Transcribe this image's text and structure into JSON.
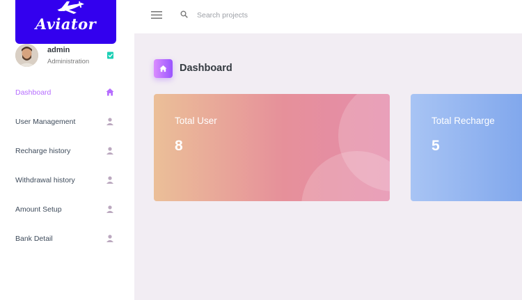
{
  "brand": {
    "name": "Aviator"
  },
  "profile": {
    "name": "admin",
    "role": "Administration"
  },
  "sidebar": {
    "items": [
      {
        "label": "Dashboard",
        "icon": "home-icon",
        "active": true
      },
      {
        "label": "User Management",
        "icon": "user-icon",
        "active": false
      },
      {
        "label": "Recharge history",
        "icon": "user-icon",
        "active": false
      },
      {
        "label": "Withdrawal history",
        "icon": "user-icon",
        "active": false
      },
      {
        "label": "Amount Setup",
        "icon": "user-icon",
        "active": false
      },
      {
        "label": "Bank Detail",
        "icon": "user-icon",
        "active": false
      }
    ]
  },
  "topbar": {
    "search_placeholder": "Search projects",
    "search_value": ""
  },
  "page": {
    "title": "Dashboard"
  },
  "cards": [
    {
      "label": "Total User",
      "value": "8"
    },
    {
      "label": "Total Recharge",
      "value": "5"
    }
  ],
  "colors": {
    "accent": "#b66dff",
    "brand": "#3300ee",
    "content_bg": "#f2edf3",
    "verified": "#1bcfb4"
  }
}
